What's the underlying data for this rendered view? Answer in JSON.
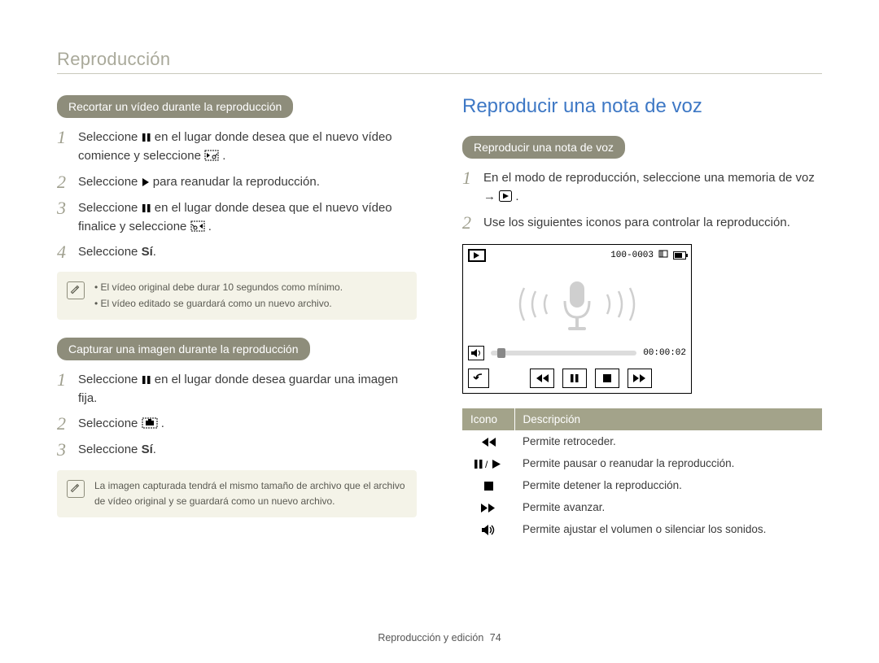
{
  "section_title": "Reproducción",
  "left": {
    "block1": {
      "heading": "Recortar un vídeo durante la reproducción",
      "steps": {
        "s1a": "Seleccione ",
        "s1b": " en el lugar donde desea que el nuevo vídeo comience y seleccione ",
        "s1c": ".",
        "s2a": "Seleccione ",
        "s2b": " para reanudar la reproducción.",
        "s3a": "Seleccione ",
        "s3b": " en el lugar donde desea que el nuevo vídeo finalice y seleccione ",
        "s3c": ".",
        "s4a": "Seleccione ",
        "s4b": "Sí",
        "s4c": "."
      },
      "notes": {
        "n1": "El vídeo original debe durar 10 segundos como mínimo.",
        "n2": "El vídeo editado se guardará como un nuevo archivo."
      }
    },
    "block2": {
      "heading": "Capturar una imagen durante la reproducción",
      "steps": {
        "s1a": "Seleccione ",
        "s1b": " en el lugar donde desea guardar una imagen fija.",
        "s2a": "Seleccione ",
        "s2b": ".",
        "s3a": "Seleccione ",
        "s3b": "Sí",
        "s3c": "."
      },
      "note": "La imagen capturada tendrá el mismo tamaño de archivo que el archivo de vídeo original y se guardará como un nuevo archivo."
    }
  },
  "right": {
    "title": "Reproducir una nota de voz",
    "block": {
      "heading": "Reproducir una nota de voz",
      "steps": {
        "s1a": "En el modo de reproducción, seleccione una memoria de voz  →  ",
        "s1b": ".",
        "s2": "Use los siguientes iconos para controlar la reproducción."
      }
    },
    "device": {
      "file_id": "100-0003",
      "time": "00:00:02"
    },
    "table": {
      "head_icon": "Icono",
      "head_desc": "Descripción",
      "rows": {
        "r1": "Permite retroceder.",
        "r2": "Permite pausar o reanudar la reproducción.",
        "r3": "Permite detener la reproducción.",
        "r4": "Permite avanzar.",
        "r5": "Permite ajustar el volumen o silenciar los sonidos."
      }
    }
  },
  "footer": {
    "text": "Reproducción y edición",
    "page": "74"
  }
}
